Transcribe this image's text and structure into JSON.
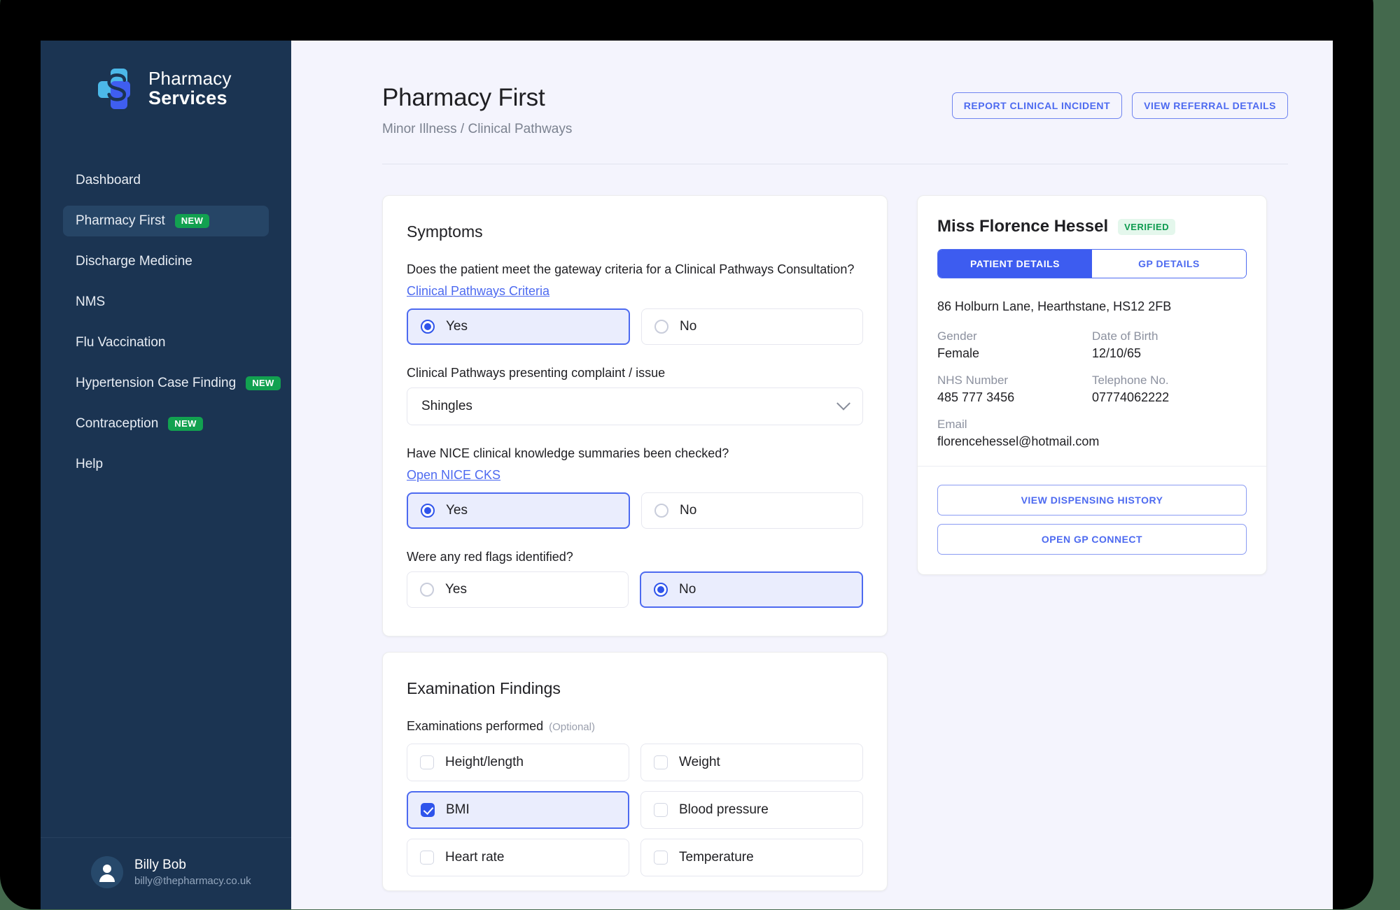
{
  "brand": {
    "line1": "Pharmacy",
    "line2": "Services"
  },
  "sidebar": {
    "items": [
      {
        "label": "Dashboard",
        "badge": "",
        "active": false
      },
      {
        "label": "Pharmacy First",
        "badge": "NEW",
        "active": true
      },
      {
        "label": "Discharge Medicine",
        "badge": "",
        "active": false
      },
      {
        "label": "NMS",
        "badge": "",
        "active": false
      },
      {
        "label": "Flu Vaccination",
        "badge": "",
        "active": false
      },
      {
        "label": "Hypertension Case Finding",
        "badge": "NEW",
        "active": false
      },
      {
        "label": "Contraception",
        "badge": "NEW",
        "active": false
      },
      {
        "label": "Help",
        "badge": "",
        "active": false
      }
    ],
    "user": {
      "name": "Billy Bob",
      "email": "billy@thepharmacy.co.uk"
    }
  },
  "header": {
    "title": "Pharmacy First",
    "breadcrumb": "Minor Illness / Clinical Pathways",
    "report_incident_label": "REPORT CLINICAL INCIDENT",
    "view_referral_label": "VIEW REFERRAL DETAILS"
  },
  "symptoms": {
    "title": "Symptoms",
    "q1": {
      "label": "Does the patient meet the gateway criteria for a Clinical Pathways Consultation?",
      "link": "Clinical Pathways Criteria",
      "options": [
        {
          "label": "Yes",
          "selected": true
        },
        {
          "label": "No",
          "selected": false
        }
      ]
    },
    "complaint": {
      "label": "Clinical Pathways presenting complaint / issue",
      "value": "Shingles"
    },
    "q2": {
      "label": "Have NICE clinical knowledge summaries been checked?",
      "link": "Open NICE CKS",
      "options": [
        {
          "label": "Yes",
          "selected": true
        },
        {
          "label": "No",
          "selected": false
        }
      ]
    },
    "q3": {
      "label": "Were any red flags identified?",
      "options": [
        {
          "label": "Yes",
          "selected": false
        },
        {
          "label": "No",
          "selected": true
        }
      ]
    }
  },
  "examination": {
    "title": "Examination Findings",
    "subtitle": "Examinations performed",
    "optional": "(Optional)",
    "items": [
      {
        "label": "Height/length",
        "checked": false
      },
      {
        "label": "Weight",
        "checked": false
      },
      {
        "label": "BMI",
        "checked": true
      },
      {
        "label": "Blood pressure",
        "checked": false
      },
      {
        "label": "Heart rate",
        "checked": false
      },
      {
        "label": "Temperature",
        "checked": false
      }
    ]
  },
  "patient": {
    "name": "Miss Florence Hessel",
    "verified_badge": "VERIFIED",
    "tabs": [
      {
        "label": "PATIENT DETAILS",
        "active": true
      },
      {
        "label": "GP DETAILS",
        "active": false
      }
    ],
    "address": "86 Holburn Lane, Hearthstane, HS12 2FB",
    "fields": [
      {
        "key": "Gender",
        "value": "Female"
      },
      {
        "key": "Date of Birth",
        "value": "12/10/65"
      },
      {
        "key": "NHS Number",
        "value": "485 777 3456"
      },
      {
        "key": "Telephone No.",
        "value": "07774062222"
      },
      {
        "key": "Email",
        "value": "florencehessel@hotmail.com"
      }
    ],
    "actions": [
      {
        "label": "VIEW DISPENSING HISTORY"
      },
      {
        "label": "OPEN GP CONNECT"
      }
    ]
  },
  "colors": {
    "sidebar_bg": "#1b3452",
    "accent_blue": "#4d6af0",
    "badge_green": "#12a150",
    "verified_green": "#0d9b4f",
    "page_bg": "#f4f4fd"
  }
}
